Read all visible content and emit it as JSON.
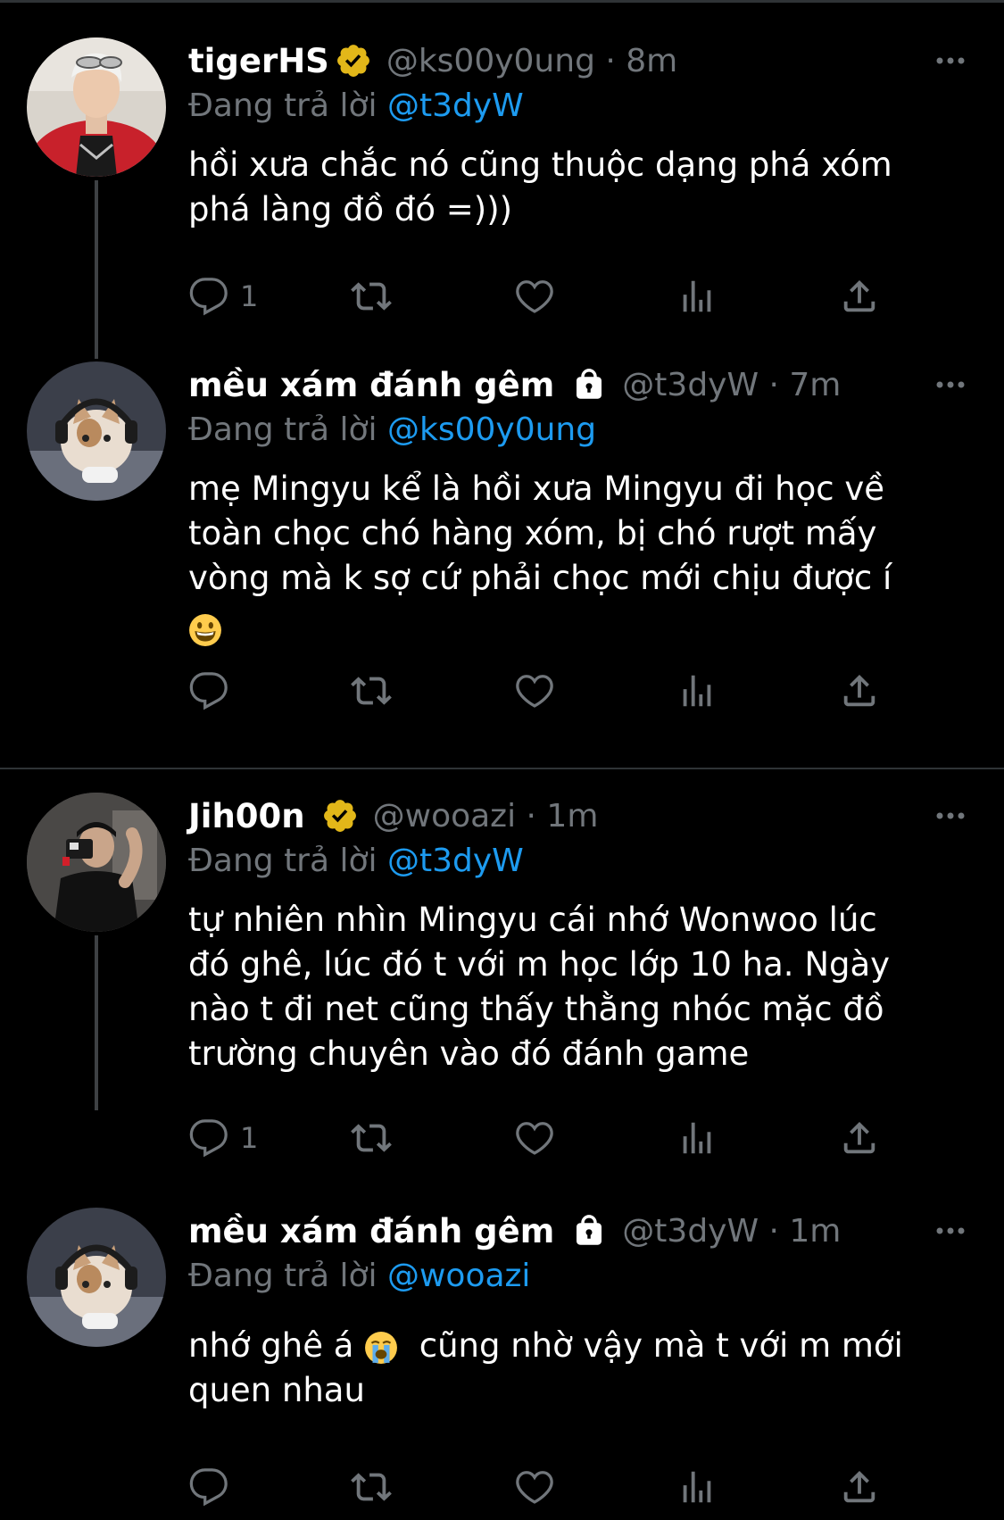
{
  "reply_prefix": "Đang trả lời",
  "colors": {
    "background": "#000000",
    "text": "#ffffff",
    "muted": "#71767b",
    "link": "#1d9bf0",
    "verified_gold": "#e2b719",
    "thread_line": "#3e4144"
  },
  "tweets": [
    {
      "name": "tigerHS",
      "badge": "verified-gold-badge-icon",
      "meta": "@ks00y0ung · 8m",
      "reply_to": "@t3dyW",
      "text": "hồi xưa chắc nó cũng thuộc dạng phá xóm\nphá làng đồ đó =)))",
      "reply_count": "1"
    },
    {
      "name": "mều xám đánh gêm",
      "badge": "lock-icon",
      "meta": "@t3dyW · 7m",
      "reply_to": "@ks00y0ung",
      "text": "mẹ Mingyu kể là hồi xưa Mingyu đi học về\ntoàn chọc chó hàng xóm, bị chó rượt mấy\nvòng mà k sợ cứ phải chọc mới chịu được í",
      "emoji": "grinning-face-emoji",
      "reply_count": ""
    },
    {
      "name": "Jih00n",
      "badge": "verified-gold-badge-icon",
      "meta": "@wooazi · 1m",
      "reply_to": "@t3dyW",
      "text": "tự nhiên nhìn Mingyu cái nhớ Wonwoo lúc\nđó ghê, lúc đó t với m học lớp 10 ha. Ngày\nnào t đi net cũng thấy thằng nhóc mặc đồ\ntrường chuyên vào đó đánh game",
      "reply_count": "1"
    },
    {
      "name": "mều xám đánh gêm",
      "badge": "lock-icon",
      "meta": "@t3dyW · 1m",
      "reply_to": "@wooazi",
      "text_before": "nhớ ghê á ",
      "text_emoji": "loudly-crying-face-emoji",
      "text_after": "  cũng nhờ vậy mà t với m mới\nquen nhau",
      "reply_count": ""
    }
  ]
}
